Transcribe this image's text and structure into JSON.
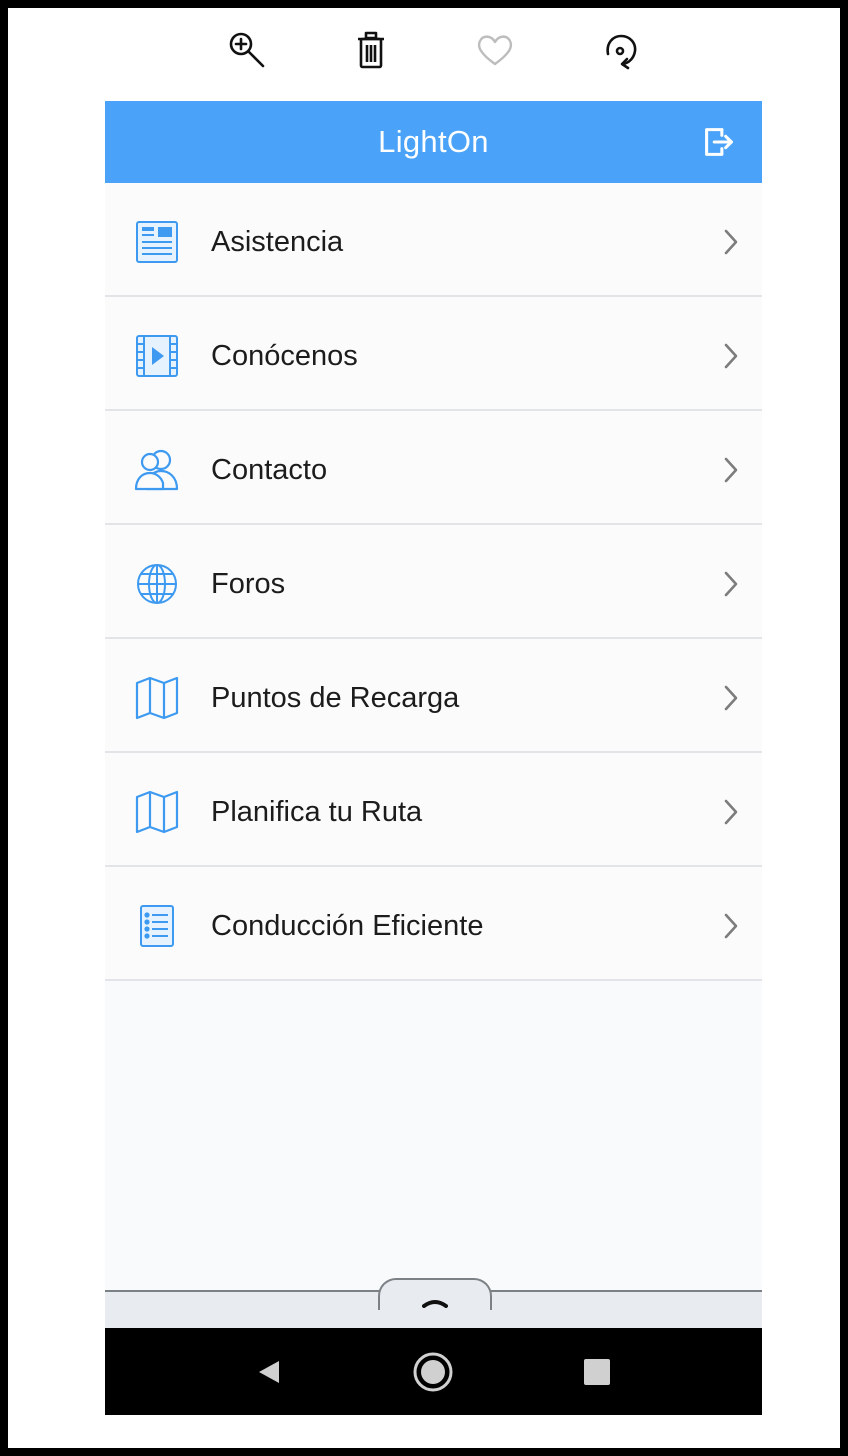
{
  "viewer_toolbar": {
    "icons": [
      "zoom-in-icon",
      "trash-icon",
      "heart-icon",
      "rotate-icon"
    ]
  },
  "app": {
    "title": "LightOn",
    "accent_color": "#4aa3f9",
    "icon_color": "#3d9af0"
  },
  "menu": {
    "items": [
      {
        "label": "Asistencia",
        "icon": "newspaper-icon"
      },
      {
        "label": "Conócenos",
        "icon": "video-film-icon"
      },
      {
        "label": "Contacto",
        "icon": "people-icon"
      },
      {
        "label": "Foros",
        "icon": "globe-icon"
      },
      {
        "label": "Puntos de Recarga",
        "icon": "map-icon"
      },
      {
        "label": "Planifica tu Ruta",
        "icon": "map-icon"
      },
      {
        "label": "Conducción Eficiente",
        "icon": "list-icon"
      }
    ]
  },
  "system_nav": {
    "icons": [
      "back-icon",
      "home-icon",
      "recents-icon"
    ]
  }
}
